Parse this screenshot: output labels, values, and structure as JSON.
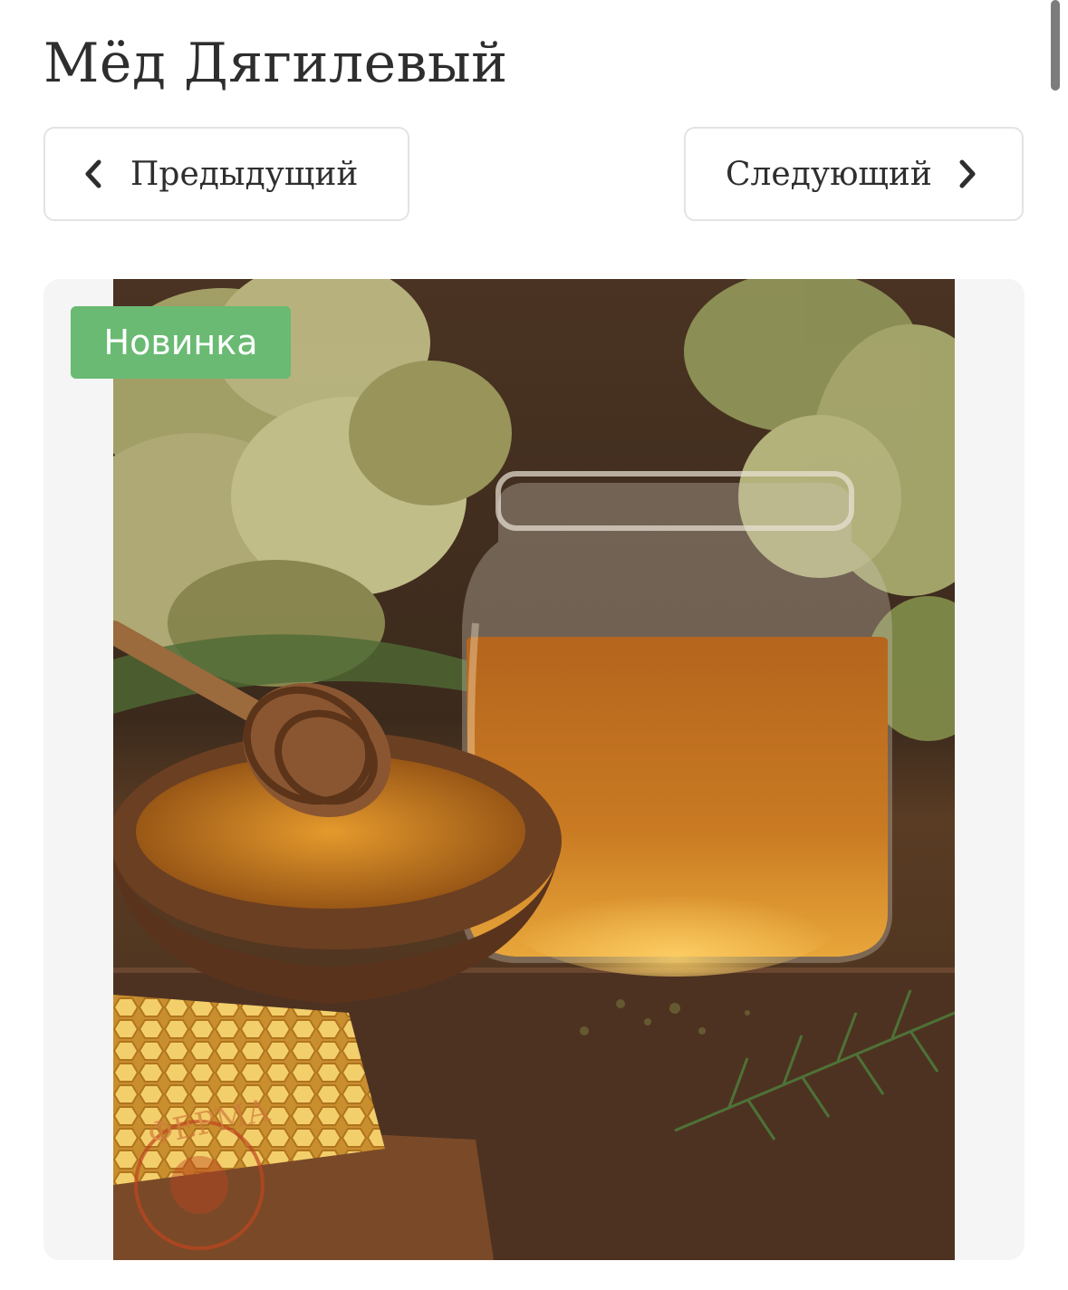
{
  "product": {
    "title": "Мёд Дягилевый"
  },
  "navigation": {
    "prev_label": "Предыдущий",
    "next_label": "Следующий"
  },
  "gallery": {
    "badge": "Новинка",
    "watermark_text": "ФЕРМА",
    "badge_color": "#6aba73"
  },
  "icons": {
    "prev": "chevron-left-icon",
    "next": "chevron-right-icon"
  }
}
